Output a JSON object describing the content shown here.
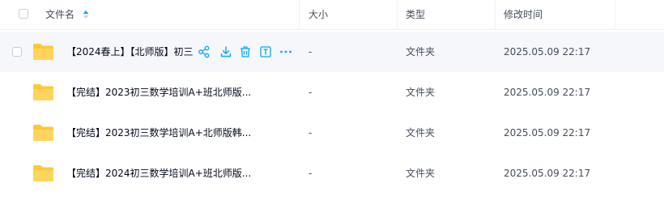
{
  "header": {
    "col_name": "文件名",
    "col_size": "大小",
    "col_type": "类型",
    "col_modified": "修改时间"
  },
  "accent_color": "#06a7ff",
  "folder_color": "#ffc933",
  "rows": [
    {
      "name": "【2024春上】【北师版】初三",
      "size": "-",
      "type": "文件夹",
      "modified": "2025.05.09 22:17"
    },
    {
      "name": "【完结】2023初三数学培训A+班北师版...",
      "size": "-",
      "type": "文件夹",
      "modified": "2025.05.09 22:17"
    },
    {
      "name": "【完结】2023初三数学培训A+北师版韩...",
      "size": "-",
      "type": "文件夹",
      "modified": "2025.05.09 22:17"
    },
    {
      "name": "【完结】2024初三数学培训A+班北师版...",
      "size": "-",
      "type": "文件夹",
      "modified": "2025.05.09 22:17"
    }
  ],
  "row_actions": [
    "share-icon",
    "download-icon",
    "delete-icon",
    "rename-icon",
    "more-icon"
  ]
}
